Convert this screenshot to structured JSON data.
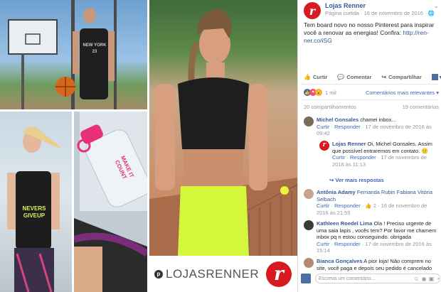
{
  "photo": {
    "watermark_text": "LOJASRENNER",
    "logo_letter": "r",
    "jersey_text": "NEW YORK 23",
    "shirt_text": "NEVERS GIVEUP",
    "bottle_text": "MAKE IT COUNT"
  },
  "post": {
    "page_name": "Lojas Renner",
    "meta": "Página curtida · 16 de novembro de 2016 ·",
    "text": "Tem board novo no nosso Pinterest para inspirar você a renovar as energias! Confira: ",
    "link": "http://ren-ner.co/iSG",
    "actions": {
      "like": "Curtir",
      "comment": "Comentar",
      "share": "Compartilhar"
    },
    "reactions_count": "1 mil",
    "sort_label": "Comentários mais relevantes",
    "shares": "20 compartilhamentos",
    "comments_count": "19 comentários"
  },
  "comments": [
    {
      "name": "Michel Gonsales",
      "text": " chamei inbox...",
      "meta_like": "Curtir",
      "meta_reply": "Responder",
      "time": "17 de novembro de 2016 às 09:42"
    },
    {
      "name": "Lojas Renner",
      "text": " Oi, Michel Gonsales. Assim que possível entraremos em contato. 🙂",
      "meta_like": "Curtir",
      "meta_reply": "Responder",
      "time": "17 de novembro de 2016 às 11:13"
    },
    {
      "name": "Antônia Adamy",
      "text": " Fernanda Rubin Fabiana Vitória Selbach",
      "meta_like": "Curtir",
      "meta_reply": "Responder",
      "reactions": "2",
      "time": "16 de novembro de 2016 às 21:55"
    },
    {
      "name": "Kathleen Roedel Lima",
      "text": " Ola ! Preciso urgente de uma saia lapis , vocês tem? Por favor me chamem inbox pq n estou conseguindo. obrigada",
      "meta_like": "Curtir",
      "meta_reply": "Responder",
      "time": "17 de novembro de 2016 às 15:14"
    },
    {
      "name": "Bianca Gonçalves",
      "text": " A pior loja! Não comprem no site, você paga e depois seu pedido é cancelado"
    }
  ],
  "more_replies": "Ver mais respostas",
  "write_placeholder": "Escreva um comentário..."
}
